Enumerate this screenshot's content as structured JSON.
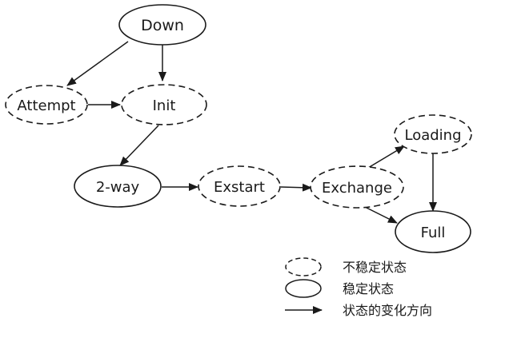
{
  "nodes": {
    "down": {
      "label": "Down",
      "state": "stable"
    },
    "attempt": {
      "label": "Attempt",
      "state": "unstable"
    },
    "init": {
      "label": "Init",
      "state": "unstable"
    },
    "two_way": {
      "label": "2-way",
      "state": "stable"
    },
    "exstart": {
      "label": "Exstart",
      "state": "unstable"
    },
    "exchange": {
      "label": "Exchange",
      "state": "unstable"
    },
    "loading": {
      "label": "Loading",
      "state": "unstable"
    },
    "full": {
      "label": "Full",
      "state": "stable"
    }
  },
  "transitions": [
    {
      "from": "Down",
      "to": "Attempt"
    },
    {
      "from": "Down",
      "to": "Init"
    },
    {
      "from": "Attempt",
      "to": "Init"
    },
    {
      "from": "Init",
      "to": "2-way"
    },
    {
      "from": "2-way",
      "to": "Exstart"
    },
    {
      "from": "Exstart",
      "to": "Exchange"
    },
    {
      "from": "Exchange",
      "to": "Loading"
    },
    {
      "from": "Exchange",
      "to": "Full"
    },
    {
      "from": "Loading",
      "to": "Full"
    }
  ],
  "legend": {
    "unstable_label": "不稳定状态",
    "stable_label": "稳定状态",
    "arrow_label": "状态的变化方向"
  },
  "colors": {
    "stroke": "#1a1a1a",
    "text": "#1a1a1a",
    "background": "#ffffff"
  }
}
